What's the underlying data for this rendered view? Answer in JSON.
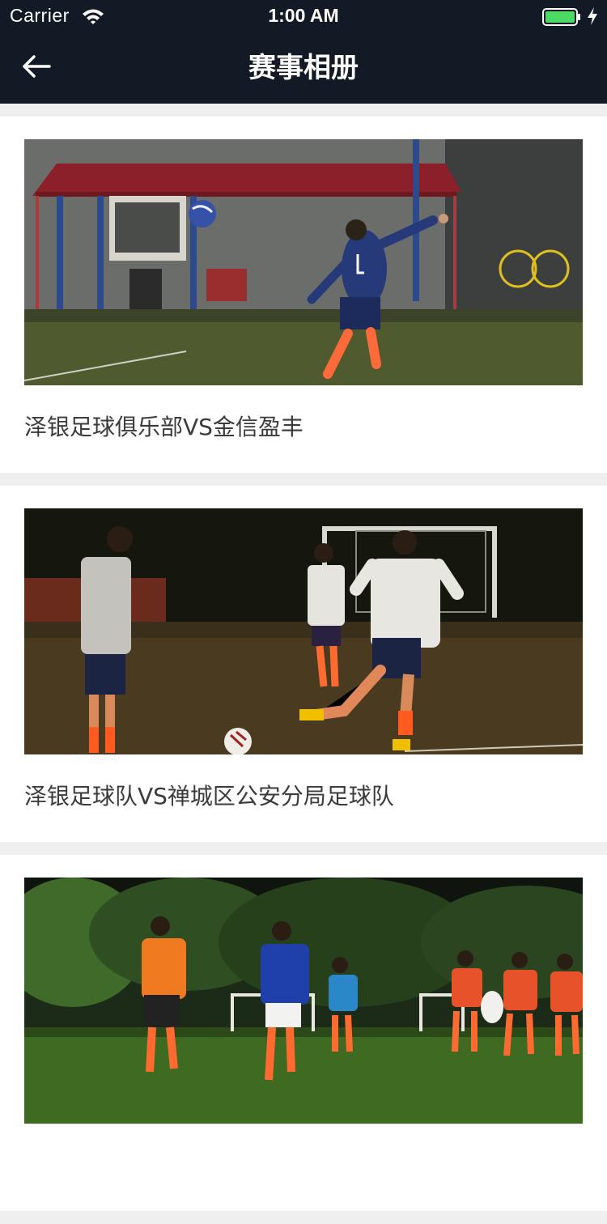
{
  "status_bar": {
    "carrier": "Carrier",
    "time": "1:00 AM",
    "wifi_icon": "wifi-icon",
    "battery_icon": "battery-icon",
    "charging_icon": "charging-bolt-icon",
    "battery_color": "#4cd964"
  },
  "nav": {
    "title": "赛事相册",
    "back_icon": "arrow-left-icon",
    "background": "#141a25"
  },
  "albums": [
    {
      "title": "泽银足球俱乐部VS金信盈丰"
    },
    {
      "title": "泽银足球队VS禅城区公安分局足球队"
    },
    {
      "title": ""
    }
  ]
}
